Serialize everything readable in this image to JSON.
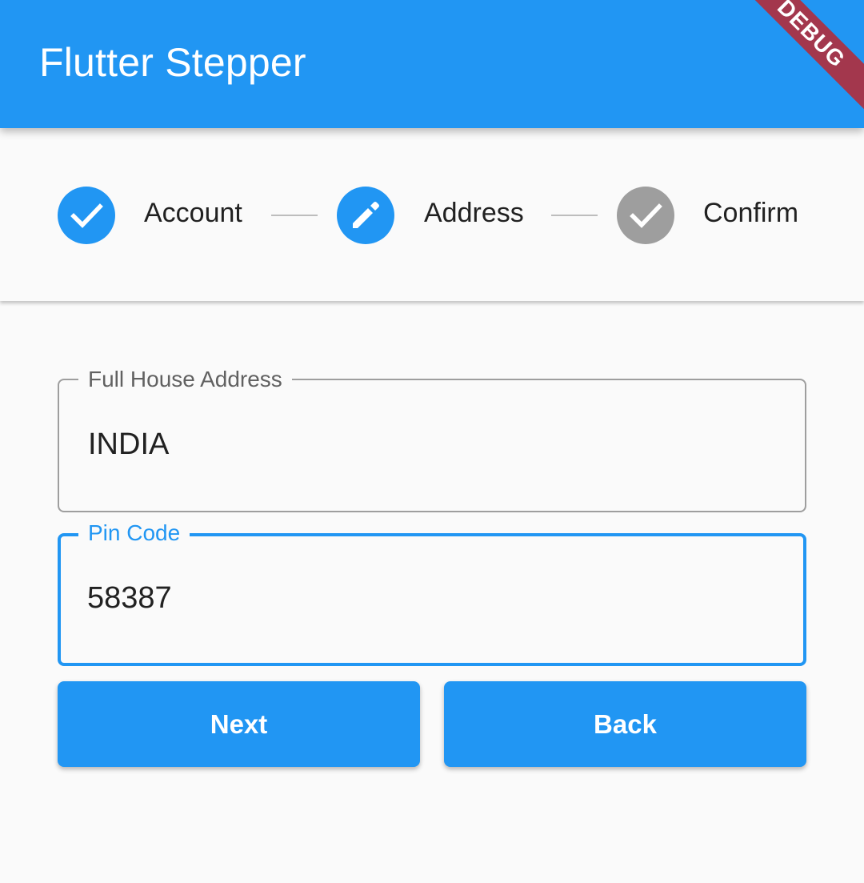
{
  "app_bar": {
    "title": "Flutter Stepper",
    "debug_banner": "DEBUG"
  },
  "stepper": {
    "steps": [
      {
        "label": "Account",
        "state": "complete",
        "icon": "check-icon",
        "color": "#2196f3"
      },
      {
        "label": "Address",
        "state": "editing",
        "icon": "edit-icon",
        "color": "#2196f3"
      },
      {
        "label": "Confirm",
        "state": "disabled",
        "icon": "check-icon",
        "color": "#9e9e9e"
      }
    ]
  },
  "form": {
    "address": {
      "label": "Full House Address",
      "value": "INDIA"
    },
    "pin": {
      "label": "Pin Code",
      "value": "58387"
    }
  },
  "buttons": {
    "next_label": "Next",
    "back_label": "Back"
  },
  "colors": {
    "primary": "#2196f3",
    "debug_banner": "#a3374d",
    "inactive_step": "#9e9e9e",
    "unfocused_border": "#9e9e9e",
    "background": "#fafafa"
  }
}
